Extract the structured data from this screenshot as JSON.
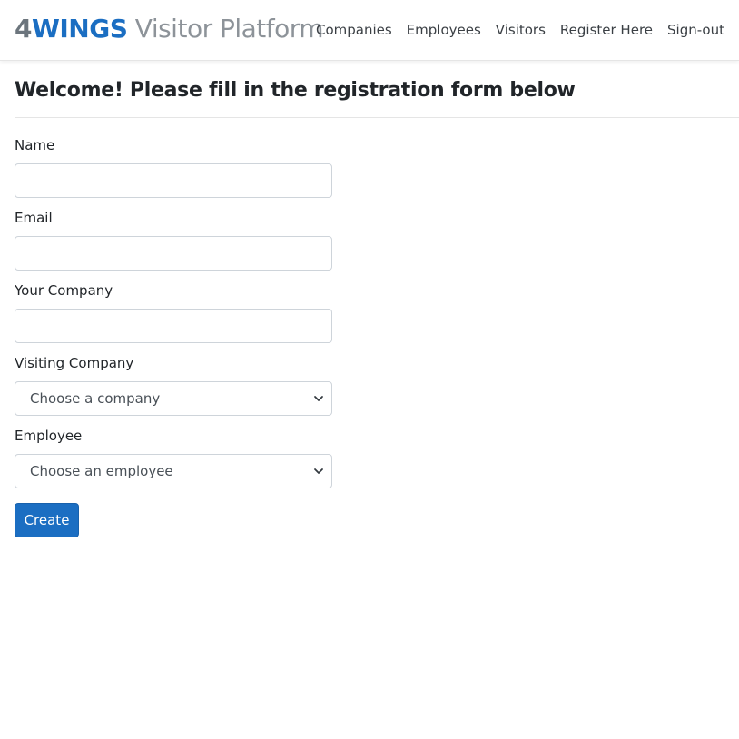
{
  "brand": {
    "part1": "4",
    "part2": "WINGS",
    "part3": " Visitor Platform"
  },
  "nav": {
    "items": [
      "Companies",
      "Employees",
      "Visitors",
      "Register Here",
      "Sign-out"
    ]
  },
  "page": {
    "title": "Welcome! Please fill in the registration form below"
  },
  "form": {
    "name_label": "Name",
    "name_value": "",
    "email_label": "Email",
    "email_value": "",
    "company_label": "Your Company",
    "company_value": "",
    "visiting_label": "Visiting Company",
    "visiting_selected": "Choose a company",
    "employee_label": "Employee",
    "employee_selected": "Choose an employee",
    "submit_label": "Create"
  },
  "colors": {
    "brand_grey": "#6c757d",
    "brand_blue": "#1b6ec2",
    "primary_button": "#1b6ec2"
  },
  "icons": {
    "select_arrow": "chevron-down-icon"
  }
}
